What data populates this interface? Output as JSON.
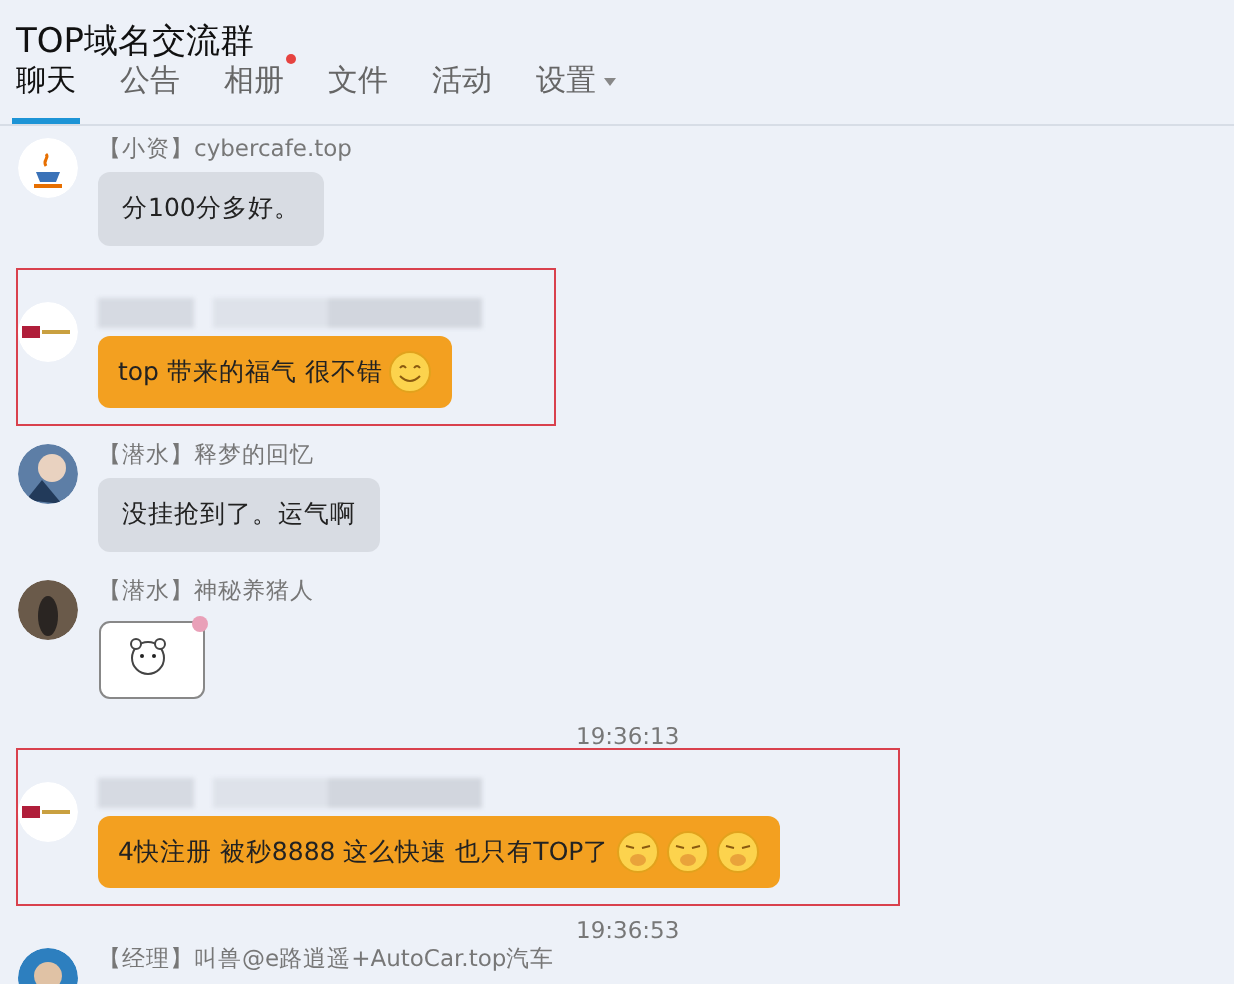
{
  "window": {
    "title": "TOP域名交流群"
  },
  "tabs": [
    {
      "label": "聊天",
      "selected": true,
      "badge": false,
      "menu": false
    },
    {
      "label": "公告",
      "selected": false,
      "badge": false,
      "menu": false
    },
    {
      "label": "相册",
      "selected": false,
      "badge": true,
      "menu": false
    },
    {
      "label": "文件",
      "selected": false,
      "badge": false,
      "menu": false
    },
    {
      "label": "活动",
      "selected": false,
      "badge": false,
      "menu": false
    },
    {
      "label": "设置",
      "selected": false,
      "badge": false,
      "menu": true
    }
  ],
  "messages": [
    {
      "kind": "text",
      "sender": "【小资】cybercafe.top",
      "text": "分100分多好。",
      "highlighted": false
    },
    {
      "kind": "text",
      "sender_hidden": true,
      "text": "top 带来的福气 很不错",
      "highlighted": true,
      "emojis": [
        {
          "kind": "smile"
        }
      ]
    },
    {
      "kind": "text",
      "sender": "【潜水】释梦的回忆",
      "text": "没挂抢到了。运气啊",
      "highlighted": false
    },
    {
      "kind": "sticker",
      "sender": "【潜水】神秘养猪人",
      "highlighted": false
    },
    {
      "kind": "time",
      "text": "19:36:13"
    },
    {
      "kind": "text",
      "sender_hidden": true,
      "text": "4快注册 被秒8888 这么快速 也只有TOP了",
      "highlighted": true,
      "emojis": [
        {
          "kind": "yawn"
        },
        {
          "kind": "yawn"
        },
        {
          "kind": "yawn"
        }
      ]
    },
    {
      "kind": "time",
      "text": "19:36:53"
    },
    {
      "kind": "partial",
      "sender": "【经理】叫兽@e路逍遥+AutoCar.top汽车"
    }
  ]
}
